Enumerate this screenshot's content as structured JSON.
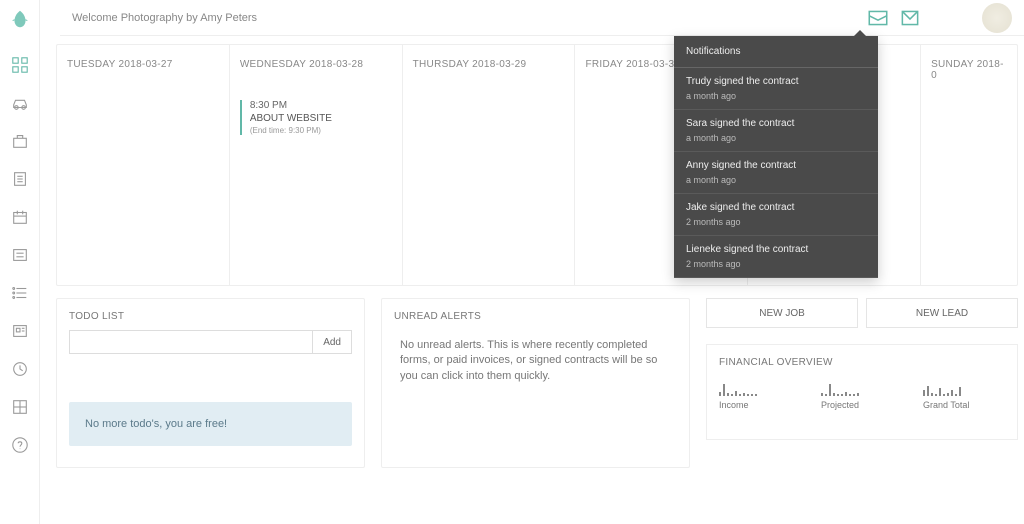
{
  "header": {
    "welcome": "Welcome Photography by Amy Peters"
  },
  "calendar": {
    "days": [
      {
        "label": "TUESDAY 2018-03-27"
      },
      {
        "label": "WEDNESDAY 2018-03-28",
        "event": {
          "time": "8:30 PM",
          "title": "ABOUT WEBSITE",
          "end": "(End time: 9:30 PM)"
        }
      },
      {
        "label": "THURSDAY 2018-03-29"
      },
      {
        "label": "FRIDAY 2018-03-3"
      },
      {
        "label": ""
      },
      {
        "label": "SUNDAY 2018-0"
      }
    ]
  },
  "todo": {
    "heading": "TODO LIST",
    "add_label": "Add",
    "empty_message": "No more todo's, you are free!"
  },
  "alerts": {
    "heading": "UNREAD ALERTS",
    "empty_message": "No unread alerts. This is where recently completed forms, or paid invoices, or signed contracts will be so you can click into them quickly."
  },
  "actions": {
    "new_job": "NEW JOB",
    "new_lead": "NEW LEAD"
  },
  "financial": {
    "heading": "FINANCIAL OVERVIEW",
    "items": [
      {
        "label": "Income"
      },
      {
        "label": "Projected"
      },
      {
        "label": "Grand Total"
      }
    ]
  },
  "notifications": {
    "heading": "Notifications",
    "items": [
      {
        "msg": "Trudy signed the contract",
        "time": "a month ago"
      },
      {
        "msg": "Sara signed the contract",
        "time": "a month ago"
      },
      {
        "msg": "Anny signed the contract",
        "time": "a month ago"
      },
      {
        "msg": "Jake signed the contract",
        "time": "2 months ago"
      },
      {
        "msg": "Lieneke signed the contract",
        "time": "2 months ago"
      }
    ]
  }
}
